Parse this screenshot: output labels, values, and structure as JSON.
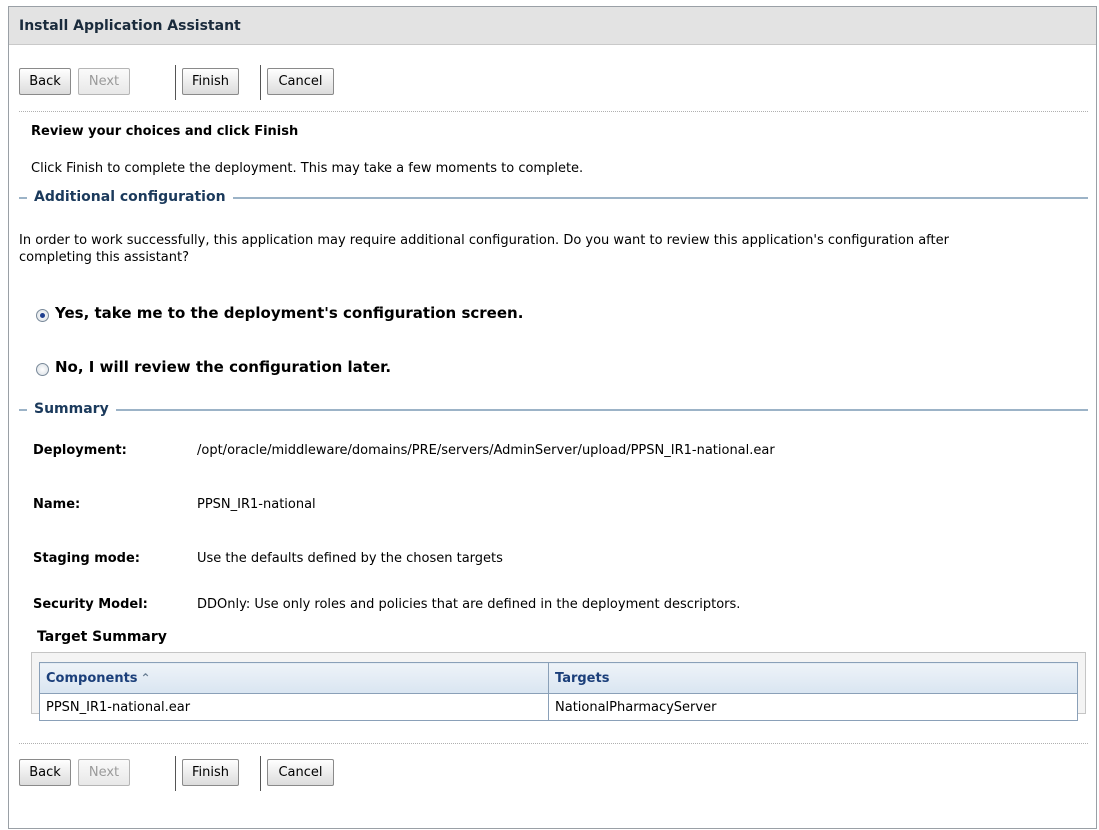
{
  "window": {
    "title": "Install Application Assistant"
  },
  "toolbar": {
    "back_label": "Back",
    "next_label": "Next",
    "finish_label": "Finish",
    "cancel_label": "Cancel"
  },
  "review": {
    "heading": "Review your choices and click Finish",
    "description": "Click Finish to complete the deployment. This may take a few moments to complete."
  },
  "additional_config": {
    "section_title": "Additional configuration",
    "text_line1": "In order to work successfully, this application may require additional configuration. Do you want to review this application's configuration after",
    "text_line2": "completing this assistant?",
    "options": [
      {
        "label": "Yes, take me to the deployment's configuration screen.",
        "selected": true
      },
      {
        "label": "No, I will review the configuration later.",
        "selected": false
      }
    ]
  },
  "summary": {
    "section_title": "Summary",
    "deployment_label": "Deployment:",
    "deployment_value": "/opt/oracle/middleware/domains/PRE/servers/AdminServer/upload/PPSN_IR1-national.ear",
    "name_label": "Name:",
    "name_value": "PPSN_IR1-national",
    "staging_label": "Staging mode:",
    "staging_value": "Use the defaults defined by the chosen targets",
    "security_label": "Security Model:",
    "security_value": "DDOnly: Use only roles and policies that are defined in the deployment descriptors."
  },
  "target_summary": {
    "title": "Target Summary",
    "columns": [
      "Components",
      "Targets"
    ],
    "rows": [
      {
        "component": "PPSN_IR1-national.ear",
        "target": "NationalPharmacyServer"
      }
    ]
  }
}
